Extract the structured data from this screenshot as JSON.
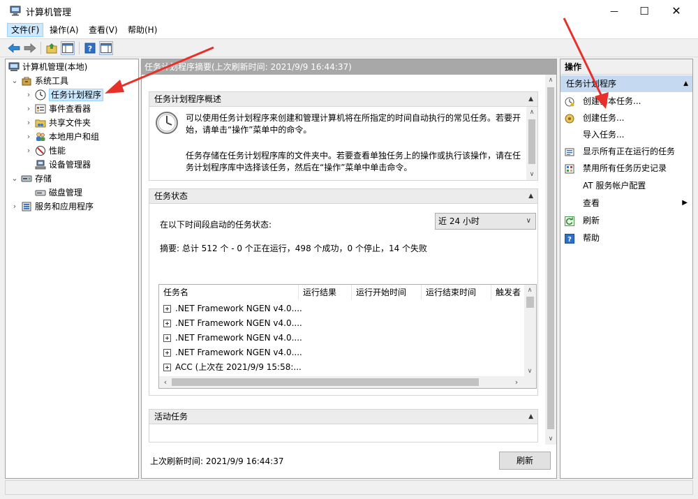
{
  "window": {
    "title": "计算机管理",
    "minimize_glyph": "—",
    "maximize_glyph": "☐",
    "close_glyph": "✕"
  },
  "menu": [
    {
      "label": "文件(F)"
    },
    {
      "label": "操作(A)"
    },
    {
      "label": "查看(V)"
    },
    {
      "label": "帮助(H)"
    }
  ],
  "toolbar": {
    "icons": [
      "back-arrow-icon",
      "forward-arrow-icon",
      "up-folder-icon",
      "show-hide-console-tree-icon",
      "help-icon",
      "show-hide-action-pane-icon"
    ]
  },
  "tree": {
    "root": "计算机管理(本地)",
    "system_tools": "系统工具",
    "task_scheduler": "任务计划程序",
    "event_viewer": "事件查看器",
    "shared_folders": "共享文件夹",
    "local_users": "本地用户和组",
    "performance": "性能",
    "device_manager": "设备管理器",
    "storage": "存储",
    "disk_management": "磁盘管理",
    "services_apps": "服务和应用程序"
  },
  "center": {
    "header": "任务计划程序摘要(上次刷新时间: 2021/9/9 16:44:37)",
    "overview_title": "任务计划程序概述",
    "overview_p1": "可以使用任务计划程序来创建和管理计算机将在所指定的时间自动执行的常见任务。若要开始，请单击“操作”菜单中的命令。",
    "overview_p2": "任务存储在任务计划程序库的文件夹中。若要查看单独任务上的操作或执行该操作，请在任务计划程序库中选择该任务，然后在“操作”菜单中单击命令。",
    "status_title": "任务状态",
    "status_label": "在以下时间段启动的任务状态:",
    "period_value": "近 24 小时",
    "summary": "摘要: 总计 512 个 - 0 个正在运行，498 个成功，0 个停止，14 个失败",
    "table_headers": [
      "任务名",
      "运行结果",
      "运行开始时间",
      "运行结束时间",
      "触发者"
    ],
    "tasks": [
      ".NET Framework NGEN v4.0....",
      ".NET Framework NGEN v4.0....",
      ".NET Framework NGEN v4.0....",
      ".NET Framework NGEN v4.0....",
      "ACC (上次在 2021/9/9 15:58:..."
    ],
    "active_title": "活动任务",
    "last_refresh": "上次刷新时间: 2021/9/9 16:44:37",
    "refresh_button": "刷新"
  },
  "actions": {
    "title": "操作",
    "section": "任务计划程序",
    "items": [
      "创建基本任务...",
      "创建任务...",
      "导入任务...",
      "显示所有正在运行的任务",
      "禁用所有任务历史记录",
      "AT 服务帐户配置",
      "查看",
      "刷新",
      "帮助"
    ]
  },
  "colors": {
    "selection": "#cce8ff",
    "header_gray": "#a8a8a8",
    "actions_section": "#c5d9f1",
    "annotation_arrow": "#e8302a"
  }
}
